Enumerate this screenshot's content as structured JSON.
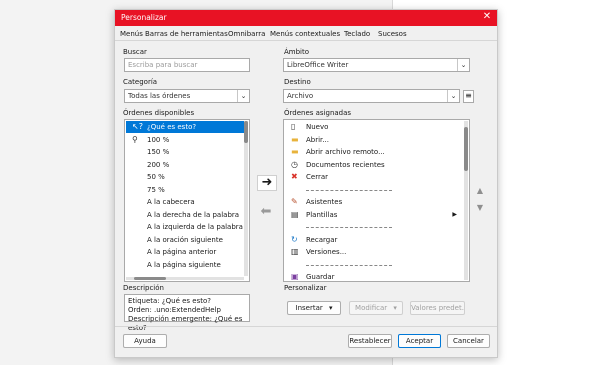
{
  "window": {
    "title": "Personalizar",
    "close_glyph": "✕"
  },
  "tabs": [
    "Menús",
    "Barras de herramientas",
    "Omnibarra",
    "Menús contextuales",
    "Teclado",
    "Sucesos"
  ],
  "search": {
    "label": "Buscar",
    "placeholder": "Escriba para buscar",
    "value": ""
  },
  "category": {
    "label": "Categoría",
    "value": "Todas las órdenes"
  },
  "scope": {
    "label": "Ámbito",
    "value": "LibreOffice Writer"
  },
  "target": {
    "label": "Destino",
    "value": "Archivo"
  },
  "available": {
    "label": "Órdenes disponibles",
    "items": [
      {
        "label": "¿Qué es esto?",
        "icon": "whats-this-icon",
        "selected": true
      },
      {
        "label": "100 %",
        "icon": "zoom-icon"
      },
      {
        "label": "150 %",
        "icon": ""
      },
      {
        "label": "200 %",
        "icon": ""
      },
      {
        "label": "50 %",
        "icon": ""
      },
      {
        "label": "75 %",
        "icon": ""
      },
      {
        "label": "A la cabecera",
        "icon": ""
      },
      {
        "label": "A la derecha de la palabra",
        "icon": ""
      },
      {
        "label": "A la izquierda de la palabra",
        "icon": ""
      },
      {
        "label": "A la oración siguiente",
        "icon": ""
      },
      {
        "label": "A la página anterior",
        "icon": ""
      },
      {
        "label": "A la página siguiente",
        "icon": ""
      }
    ]
  },
  "assigned": {
    "label": "Órdenes asignadas",
    "items": [
      {
        "label": "Nuevo",
        "icon": "new-document-icon"
      },
      {
        "label": "Abrir...",
        "icon": "folder-icon"
      },
      {
        "label": "Abrir archivo remoto...",
        "icon": "folder-icon"
      },
      {
        "label": "Documentos recientes",
        "icon": "clock-icon"
      },
      {
        "label": "Cerrar",
        "icon": "close-document-icon"
      },
      {
        "separator": true
      },
      {
        "label": "Asistentes",
        "icon": "wand-icon"
      },
      {
        "label": "Plantillas",
        "icon": "template-icon",
        "submenu": true
      },
      {
        "separator": true
      },
      {
        "label": "Recargar",
        "icon": "reload-icon"
      },
      {
        "label": "Versiones...",
        "icon": "versions-icon"
      },
      {
        "separator": true
      },
      {
        "label": "Guardar",
        "icon": "save-icon"
      }
    ]
  },
  "customize_label": "Personalizar",
  "buttons": {
    "insert": "Insertar",
    "modify": "Modificar",
    "defaults": "Valores predet.",
    "help": "Ayuda",
    "reset": "Restablecer",
    "accept": "Aceptar",
    "cancel": "Cancelar"
  },
  "description": {
    "label": "Descripción",
    "lines": [
      "Etiqueta: ¿Qué es esto?",
      "Orden: .uno:ExtendedHelp",
      "Descripción emergente: ¿Qué es esto?"
    ]
  },
  "colors": {
    "titlebar": "#e81224",
    "selection": "#0078d7"
  }
}
